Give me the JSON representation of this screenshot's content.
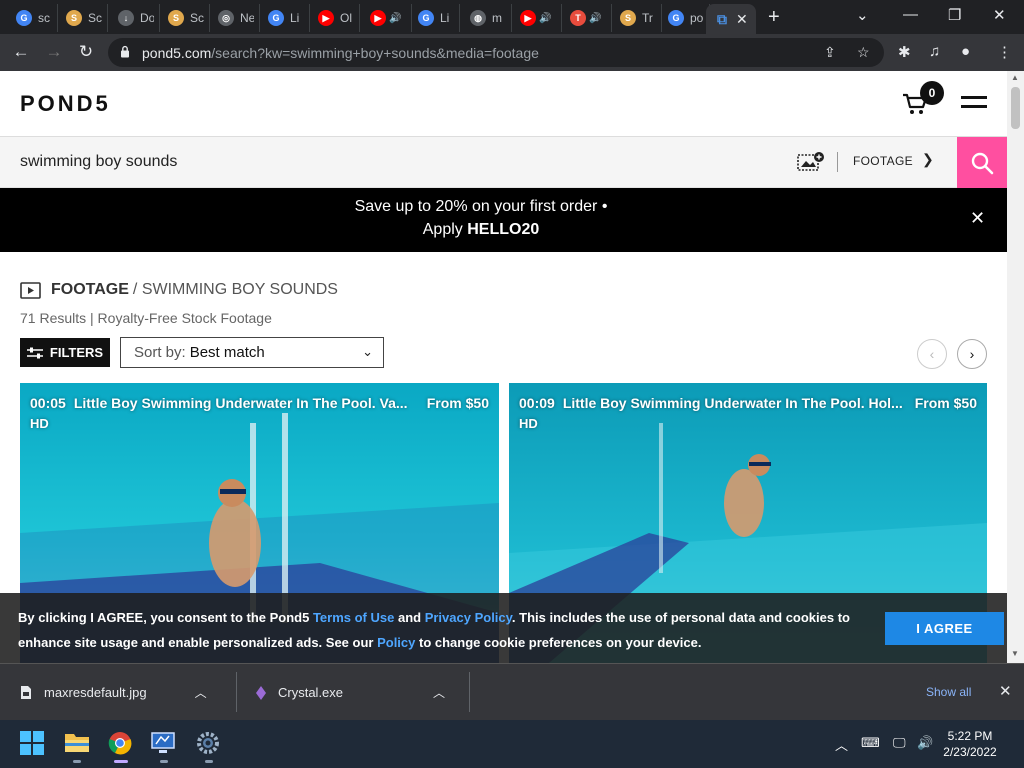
{
  "browser": {
    "tabs": [
      {
        "label": "sc",
        "icon": "google-icon",
        "color": "#4285f4",
        "glyph": "G"
      },
      {
        "label": "Sc",
        "icon": "shield-icon",
        "color": "#e0a84d",
        "glyph": "S"
      },
      {
        "label": "Do",
        "icon": "download-icon",
        "color": "#5f6368",
        "glyph": "↓"
      },
      {
        "label": "Sc",
        "icon": "shield-icon",
        "color": "#e0a84d",
        "glyph": "S"
      },
      {
        "label": "Ne",
        "icon": "chrome-icon",
        "color": "#5f6368",
        "glyph": "◎"
      },
      {
        "label": "Li",
        "icon": "google-icon",
        "color": "#4285f4",
        "glyph": "G"
      },
      {
        "label": "Ol",
        "icon": "youtube-icon",
        "color": "#ff0000",
        "glyph": "▶"
      },
      {
        "label": "",
        "icon": "youtube-icon",
        "color": "#ff0000",
        "glyph": "▶"
      },
      {
        "label": "Li",
        "icon": "google-icon",
        "color": "#4285f4",
        "glyph": "G"
      },
      {
        "label": "m",
        "icon": "globe-icon",
        "color": "#5f6368",
        "glyph": "◍"
      },
      {
        "label": "",
        "icon": "youtube-icon",
        "color": "#ff0000",
        "glyph": "▶"
      },
      {
        "label": "",
        "icon": "t-icon",
        "color": "#e84c3d",
        "glyph": "T"
      },
      {
        "label": "Tr",
        "icon": "shield-icon",
        "color": "#e0a84d",
        "glyph": "S"
      },
      {
        "label": "po",
        "icon": "google-icon",
        "color": "#4285f4",
        "glyph": "G"
      }
    ],
    "url_host": "pond5.com",
    "url_path": "/search?kw=swimming+boy+sounds&media=footage"
  },
  "site": {
    "logo": "POND5",
    "cart_count": "0",
    "search_query": "swimming boy sounds",
    "media_type": "FOOTAGE",
    "promo_line1": "Save up to 20% on your first order •",
    "promo_line2_prefix": "Apply ",
    "promo_code": "HELLO20",
    "breadcrumb_category": "FOOTAGE",
    "breadcrumb_term": "/ SWIMMING BOY SOUNDS",
    "results_text": "71 Results | Royalty-Free Stock Footage",
    "filters_label": "FILTERS",
    "sort_prefix": "Sort by:",
    "sort_value": "Best match",
    "clips": [
      {
        "duration": "00:05",
        "title": "Little Boy Swimming Underwater In The Pool. Va...",
        "price": "From $50",
        "quality": "HD"
      },
      {
        "duration": "00:09",
        "title": "Little Boy Swimming Underwater In The Pool. Hol...",
        "price": "From $50",
        "quality": "HD"
      }
    ],
    "cookie": {
      "part1": "By clicking I AGREE, you consent to the Pond5 ",
      "link_terms": "Terms of Use",
      "part2": " and ",
      "link_privacy": "Privacy Policy",
      "part3": ". This includes the use of personal data and cookies to enhance site usage and enable personalized ads. See our ",
      "link_policy": "Policy",
      "part4": " to change cookie preferences on your device.",
      "agree_label": "I AGREE"
    }
  },
  "downloads": {
    "items": [
      {
        "name": "maxresdefault.jpg"
      },
      {
        "name": "Crystal.exe"
      }
    ],
    "show_all": "Show all"
  },
  "taskbar": {
    "time": "5:22 PM",
    "date": "2/23/2022"
  },
  "colors": {
    "search_accent": "#ff4fa0",
    "agree_button": "#1e88e5",
    "link": "#4ea6ff"
  }
}
